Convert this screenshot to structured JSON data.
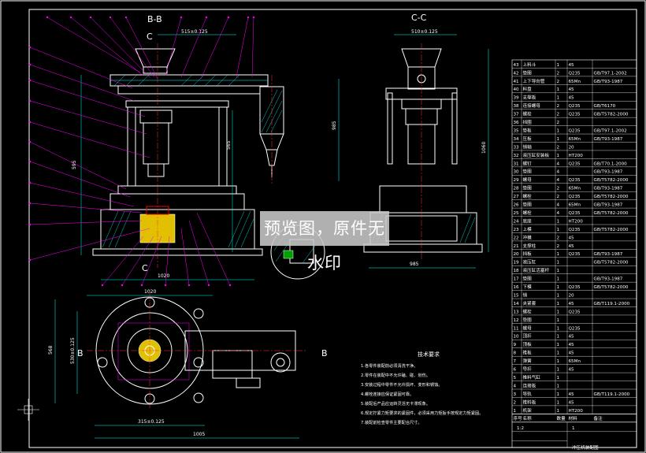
{
  "views": {
    "section_bb": "B-B",
    "section_cc": "C-C",
    "cut_c_top": "C",
    "cut_c_bottom": "C",
    "cut_b_right": "B",
    "cut_b_bottom": "B"
  },
  "watermark": "预览图，原件无水印",
  "technical_requirements": {
    "title": "技术要求",
    "notes": [
      "1.各零件装配前必须清洗干净。",
      "2.零件在装配中不允许磕、碰、划伤。",
      "3.安装过程中零件不允许损坏、变形和锈蚀。",
      "4.螺栓连接应保证紧固可靠。",
      "5.装配后产品应运转灵活无卡滞现象。",
      "6.规定拧紧力矩要求的紧固件，必须采用力矩扳手按规定力矩紧固。",
      "7.装配前检查零件主要配合尺寸。"
    ]
  },
  "bom": {
    "rows": [
      {
        "no": "43",
        "name": "上料斗",
        "qty": "1",
        "mat": "45",
        "note": ""
      },
      {
        "no": "42",
        "name": "垫圈",
        "qty": "2",
        "mat": "Q235",
        "note": "GB/T97.1-2002"
      },
      {
        "no": "41",
        "name": "上下导向管",
        "qty": "2",
        "mat": "65Mn",
        "note": "GB/T93-1987"
      },
      {
        "no": "40",
        "name": "料盘",
        "qty": "1",
        "mat": "45",
        "note": ""
      },
      {
        "no": "39",
        "name": "支撑板",
        "qty": "1",
        "mat": "45",
        "note": ""
      },
      {
        "no": "38",
        "name": "连接螺母",
        "qty": "2",
        "mat": "Q235",
        "note": "GB/T6170"
      },
      {
        "no": "37",
        "name": "螺栓",
        "qty": "2",
        "mat": "Q235",
        "note": "GB/T5782-2000"
      },
      {
        "no": "36",
        "name": "挡圈",
        "qty": "2",
        "mat": "",
        "note": ""
      },
      {
        "no": "35",
        "name": "垫板",
        "qty": "1",
        "mat": "Q235",
        "note": "GB/T97.1-2002"
      },
      {
        "no": "34",
        "name": "压板",
        "qty": "1",
        "mat": "65Mn",
        "note": "GB/T93-1987"
      },
      {
        "no": "33",
        "name": "销轴",
        "qty": "2",
        "mat": "20",
        "note": ""
      },
      {
        "no": "32",
        "name": "液压缸安装板",
        "qty": "1",
        "mat": "HT200",
        "note": ""
      },
      {
        "no": "31",
        "name": "螺钉",
        "qty": "4",
        "mat": "Q235",
        "note": "GB/T70.1-2000"
      },
      {
        "no": "30",
        "name": "垫圈",
        "qty": "4",
        "mat": "",
        "note": "GB/T93-1987"
      },
      {
        "no": "29",
        "name": "螺母",
        "qty": "4",
        "mat": "Q235",
        "note": "GB/T5782-2000"
      },
      {
        "no": "28",
        "name": "垫圈",
        "qty": "2",
        "mat": "65Mn",
        "note": "GB/T93-1987"
      },
      {
        "no": "27",
        "name": "螺栓",
        "qty": "2",
        "mat": "Q235",
        "note": "GB/T5782-2000"
      },
      {
        "no": "26",
        "name": "垫圈",
        "qty": "4",
        "mat": "65Mn",
        "note": "GB/T93-1987"
      },
      {
        "no": "25",
        "name": "螺栓",
        "qty": "4",
        "mat": "Q235",
        "note": "GB/T5782-2000"
      },
      {
        "no": "24",
        "name": "底座",
        "qty": "1",
        "mat": "HT200",
        "note": ""
      },
      {
        "no": "23",
        "name": "上模",
        "qty": "1",
        "mat": "Q235",
        "note": "GB/T5782-2000"
      },
      {
        "no": "22",
        "name": "冲模",
        "qty": "2",
        "mat": "45",
        "note": ""
      },
      {
        "no": "21",
        "name": "支撑柱",
        "qty": "2",
        "mat": "45",
        "note": ""
      },
      {
        "no": "20",
        "name": "挡板",
        "qty": "1",
        "mat": "Q235",
        "note": "GB/T93-1987"
      },
      {
        "no": "19",
        "name": "液压缸",
        "qty": "1",
        "mat": "",
        "note": "GB/T5782-2000"
      },
      {
        "no": "18",
        "name": "液压缸活塞杆",
        "qty": "1",
        "mat": "",
        "note": ""
      },
      {
        "no": "17",
        "name": "垫圈",
        "qty": "1",
        "mat": "",
        "note": "GB/T93-1987"
      },
      {
        "no": "16",
        "name": "下模",
        "qty": "1",
        "mat": "Q235",
        "note": "GB/T5782-2000"
      },
      {
        "no": "15",
        "name": "销",
        "qty": "1",
        "mat": "20",
        "note": ""
      },
      {
        "no": "14",
        "name": "夹紧套",
        "qty": "1",
        "mat": "45",
        "note": "GB/T119.1-2000"
      },
      {
        "no": "13",
        "name": "螺栓",
        "qty": "1",
        "mat": "Q235",
        "note": ""
      },
      {
        "no": "12",
        "name": "垫圈",
        "qty": "1",
        "mat": "",
        "note": ""
      },
      {
        "no": "11",
        "name": "螺母",
        "qty": "1",
        "mat": "Q235",
        "note": ""
      },
      {
        "no": "10",
        "name": "顶杆",
        "qty": "1",
        "mat": "45",
        "note": ""
      },
      {
        "no": "9",
        "name": "顶板",
        "qty": "1",
        "mat": "45",
        "note": ""
      },
      {
        "no": "8",
        "name": "推板",
        "qty": "1",
        "mat": "45",
        "note": ""
      },
      {
        "no": "7",
        "name": "弹簧",
        "qty": "1",
        "mat": "65Mn",
        "note": ""
      },
      {
        "no": "6",
        "name": "导杆",
        "qty": "1",
        "mat": "45",
        "note": ""
      },
      {
        "no": "5",
        "name": "推料气缸",
        "qty": "1",
        "mat": "",
        "note": ""
      },
      {
        "no": "4",
        "name": "连接板",
        "qty": "1",
        "mat": "",
        "note": ""
      },
      {
        "no": "3",
        "name": "导轨",
        "qty": "1",
        "mat": "45",
        "note": "GB/T119.1-2000"
      },
      {
        "no": "2",
        "name": "推料板",
        "qty": "1",
        "mat": "45",
        "note": ""
      },
      {
        "no": "1",
        "name": "机架",
        "qty": "1",
        "mat": "HT200",
        "note": ""
      }
    ],
    "header": {
      "no": "序号",
      "name": "名称",
      "qty": "数量",
      "mat": "材料",
      "note": "备注"
    },
    "title_block": {
      "title": "冲压机装配图",
      "scale": "1:2",
      "sheet": "1"
    }
  },
  "dimensions": {
    "top_width": "515±0.125",
    "cc_top": "510±0.125",
    "front_total": "1020",
    "plan_top": "1020",
    "plan_bottom": "1005",
    "plan_inner": "315±0.125",
    "cc_bottom": "985",
    "cc_height": "1060",
    "front_height": "985",
    "left_v1": "595",
    "left_v2": "565",
    "plan_left": "568",
    "plan_left2": "530±0.125"
  },
  "colors": {
    "background": "#000000",
    "outline": "#ffffff",
    "leader": "#ff00ff",
    "dimension": "#00ffff",
    "center": "#ff3030",
    "hatch": "#00ffff",
    "yellow_part": "#e0c000",
    "green": "#00d000"
  }
}
